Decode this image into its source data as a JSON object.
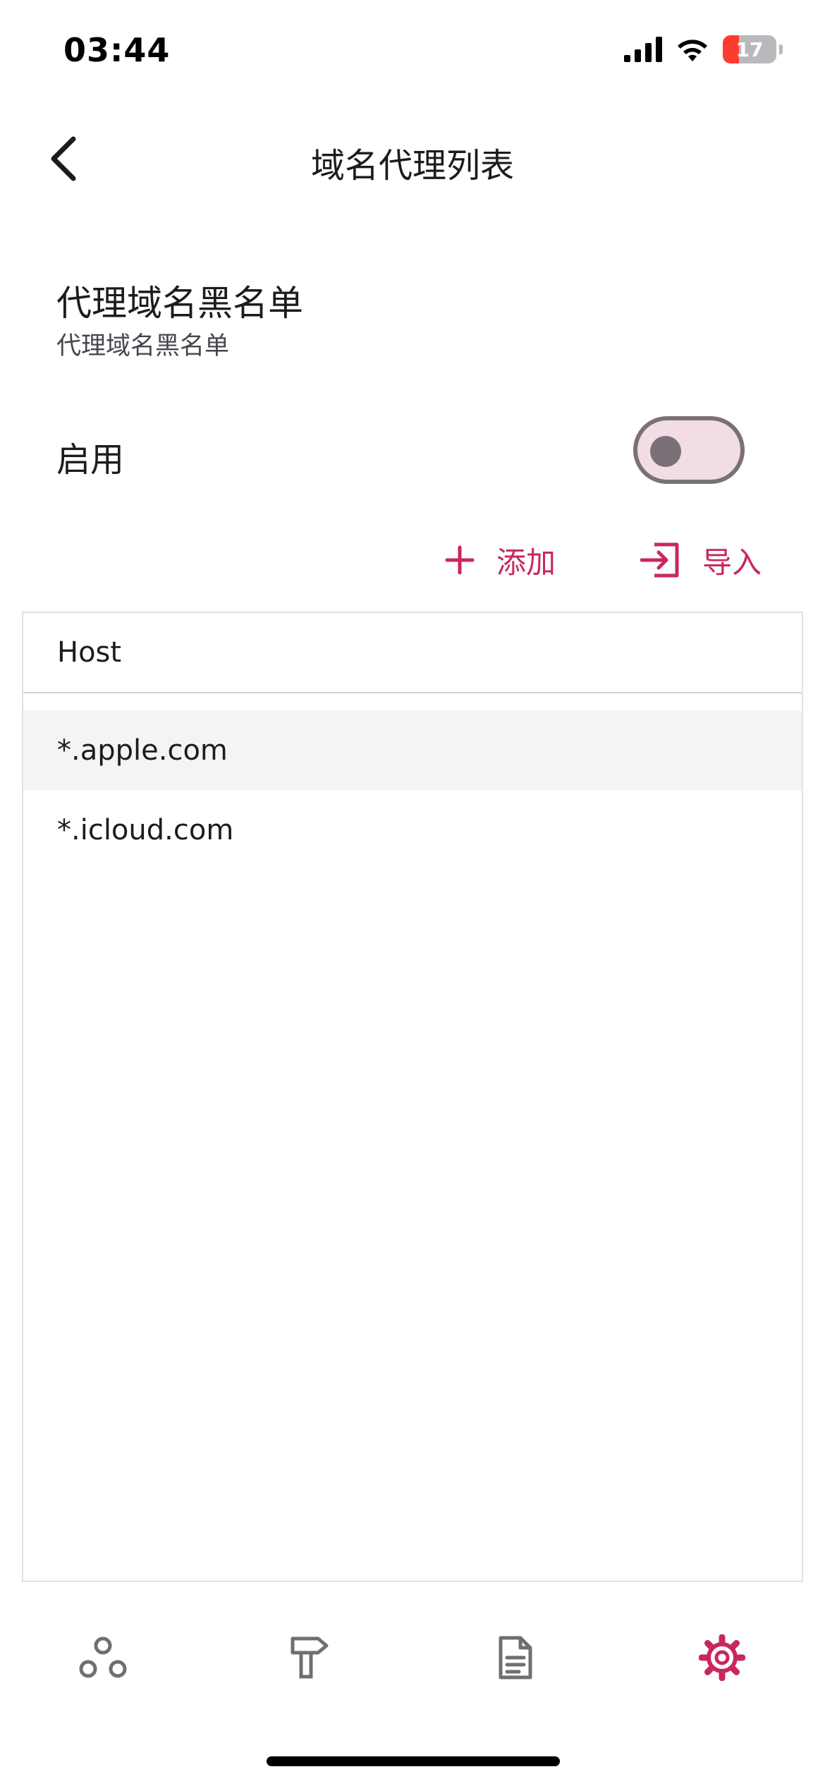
{
  "status_bar": {
    "time": "03:44",
    "battery_level": "17",
    "icons": [
      "cellular-signal-icon",
      "wifi-icon",
      "battery-charging-icon"
    ]
  },
  "app_bar": {
    "title": "域名代理列表",
    "back_icon": "chevron-left-icon"
  },
  "section": {
    "title": "代理域名黑名单",
    "subtitle": "代理域名黑名单"
  },
  "enable": {
    "label": "启用",
    "switch_on": false
  },
  "actions": {
    "add_label": "添加",
    "import_label": "导入"
  },
  "table": {
    "column_header": "Host",
    "rows": [
      "*.apple.com",
      "*.icloud.com"
    ],
    "selected_row": 0
  },
  "bottom_nav": {
    "items": [
      "nodes-icon",
      "tools-icon",
      "document-icon",
      "settings-icon"
    ],
    "active_index": 3
  },
  "colors": {
    "accent": "#c9285d",
    "icon_inactive": "#6f6f6f",
    "switch_track": "#f3dde4",
    "switch_outline": "#7a7178",
    "selected_row_bg": "#f4f4f4"
  }
}
